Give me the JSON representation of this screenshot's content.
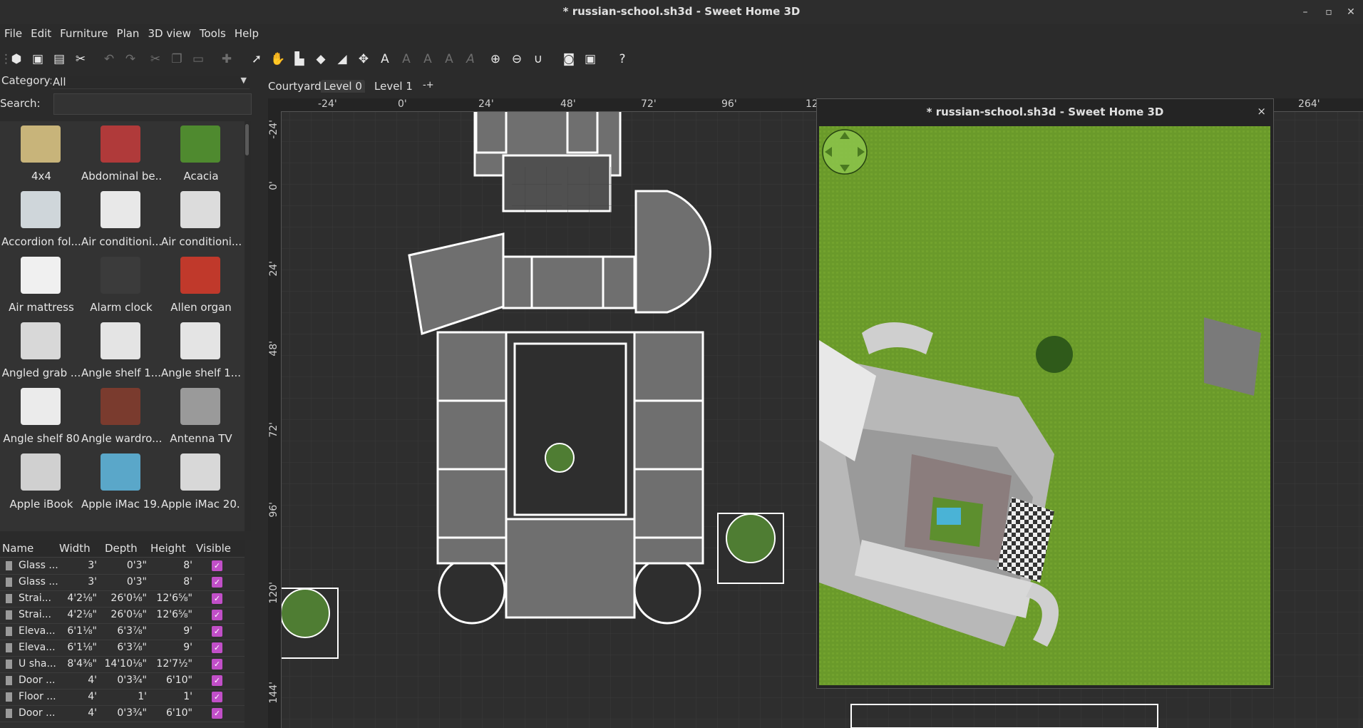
{
  "window": {
    "title": "* russian-school.sh3d - Sweet Home 3D",
    "minimize_icon": "minimize-icon",
    "maximize_icon": "maximize-icon",
    "close_icon": "close-icon"
  },
  "menu": [
    "File",
    "Edit",
    "Furniture",
    "Plan",
    "3D view",
    "Tools",
    "Help"
  ],
  "catalog": {
    "category_label": "Category:",
    "category_value": "All",
    "search_label": "Search:",
    "search_value": "",
    "items": [
      {
        "label": "4x4",
        "color": "#c8b47a"
      },
      {
        "label": "Abdominal be...",
        "color": "#b03a3a"
      },
      {
        "label": "Acacia",
        "color": "#4f8a2f"
      },
      {
        "label": "Accordion fol...",
        "color": "#cfd6da"
      },
      {
        "label": "Air conditioni...",
        "color": "#e8e8e8"
      },
      {
        "label": "Air conditioni...",
        "color": "#dcdcdc"
      },
      {
        "label": "Air mattress",
        "color": "#f0f0f0"
      },
      {
        "label": "Alarm clock",
        "color": "#3b3b3b"
      },
      {
        "label": "Allen organ",
        "color": "#c0392b"
      },
      {
        "label": "Angled grab ...",
        "color": "#d8d8d8"
      },
      {
        "label": "Angle shelf 1...",
        "color": "#e4e4e4"
      },
      {
        "label": "Angle shelf 1...",
        "color": "#e4e4e4"
      },
      {
        "label": "Angle shelf 80",
        "color": "#ebebeb"
      },
      {
        "label": "Angle wardro...",
        "color": "#7a3b2e"
      },
      {
        "label": "Antenna TV",
        "color": "#9a9a9a"
      },
      {
        "label": "Apple iBook",
        "color": "#d0d0d0"
      },
      {
        "label": "Apple iMac 19...",
        "color": "#5aa7c9"
      },
      {
        "label": "Apple iMac 20...",
        "color": "#d8d8d8"
      }
    ]
  },
  "table": {
    "headers": [
      "Name",
      "Width",
      "Depth",
      "Height",
      "Visible"
    ],
    "rows": [
      {
        "name": "Glass ...",
        "width": "3'",
        "depth": "0'3\"",
        "height": "8'",
        "visible": "✓"
      },
      {
        "name": "Glass ...",
        "width": "3'",
        "depth": "0'3\"",
        "height": "8'",
        "visible": "✓"
      },
      {
        "name": "Strai...",
        "width": "4'2⅛\"",
        "depth": "26'0⅛\"",
        "height": "12'6⅝\"",
        "visible": "✓"
      },
      {
        "name": "Strai...",
        "width": "4'2⅛\"",
        "depth": "26'0⅛\"",
        "height": "12'6⅝\"",
        "visible": "✓"
      },
      {
        "name": "Eleva...",
        "width": "6'1⅛\"",
        "depth": "6'3⅞\"",
        "height": "9'",
        "visible": "✓"
      },
      {
        "name": "Eleva...",
        "width": "6'1⅛\"",
        "depth": "6'3⅞\"",
        "height": "9'",
        "visible": "✓"
      },
      {
        "name": "U sha...",
        "width": "8'4⅜\"",
        "depth": "14'10⅛\"",
        "height": "12'7½\"",
        "visible": "✓"
      },
      {
        "name": "Door ...",
        "width": "4'",
        "depth": "0'3¾\"",
        "height": "6'10\"",
        "visible": "✓"
      },
      {
        "name": "Floor ...",
        "width": "4'",
        "depth": "1'",
        "height": "1'",
        "visible": "✓"
      },
      {
        "name": "Door ...",
        "width": "4'",
        "depth": "0'3¾\"",
        "height": "6'10\"",
        "visible": "✓"
      }
    ]
  },
  "plan": {
    "tabs": [
      "Courtyard",
      "Level 0",
      "Level 1"
    ],
    "selected_tab": "Level 0",
    "add_level_icon": "add-level-icon",
    "hruler": [
      "-24'",
      "0'",
      "24'",
      "48'",
      "72'",
      "96'",
      "12",
      "264'"
    ],
    "vruler": [
      "-24'",
      "0'",
      "24'",
      "48'",
      "72'",
      "96'",
      "120'",
      "144'"
    ]
  },
  "view3d": {
    "title": "* russian-school.sh3d - Sweet Home 3D",
    "close_label": "×",
    "navigator_icon": "navigation-arrows-icon"
  },
  "colors": {
    "background": "#2b2b2b",
    "grass": "#6a9a2a",
    "accent": "#c14fc8"
  }
}
